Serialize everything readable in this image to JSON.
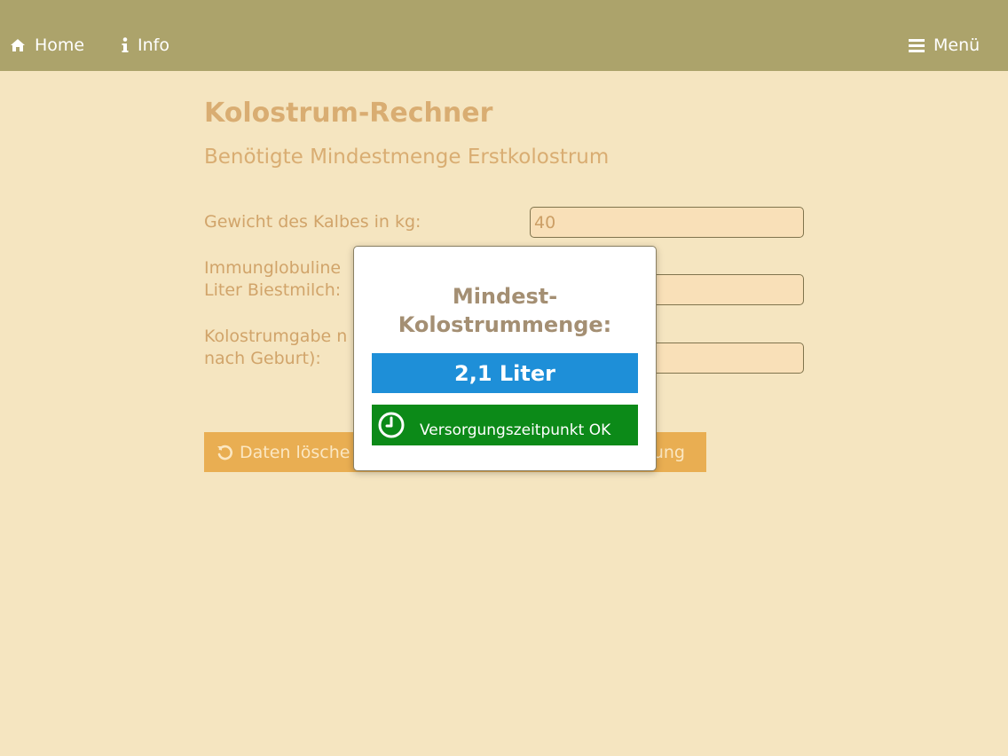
{
  "nav": {
    "home_label": "Home",
    "info_label": "Info",
    "menu_label": "Menü"
  },
  "page": {
    "title": "Kolostrum-Rechner",
    "subtitle": "Benötigte Mindestmenge Erstkolostrum"
  },
  "form": {
    "weight_label": "Gewicht des Kalbes in kg:",
    "weight_value": "40",
    "immunoglobulin_label_line1": "Immunglobuline",
    "immunoglobulin_label_line2": "Liter Biestmilch:",
    "immunoglobulin_value": "",
    "colostrum_label_line1": "Kolostrumgabe n",
    "colostrum_label_line2": "nach Geburt):",
    "colostrum_value": ""
  },
  "buttons": {
    "reset_label": "Daten lösche",
    "calculate_label": "ung"
  },
  "modal": {
    "title_line1": "Mindest-",
    "title_line2": "Kolostrummenge:",
    "result": "2,1 Liter",
    "status": "Versorgungszeitpunkt OK"
  },
  "colors": {
    "header": "#aca36b",
    "background": "#f5e5c0",
    "accent_orange": "#e9ae52",
    "result_blue": "#1e8fd8",
    "status_green": "#0c8a18"
  },
  "icons": {
    "home": "home-icon",
    "info": "info-icon",
    "menu": "hamburger-menu-icon",
    "reset": "undo-icon",
    "status": "clock-icon"
  }
}
